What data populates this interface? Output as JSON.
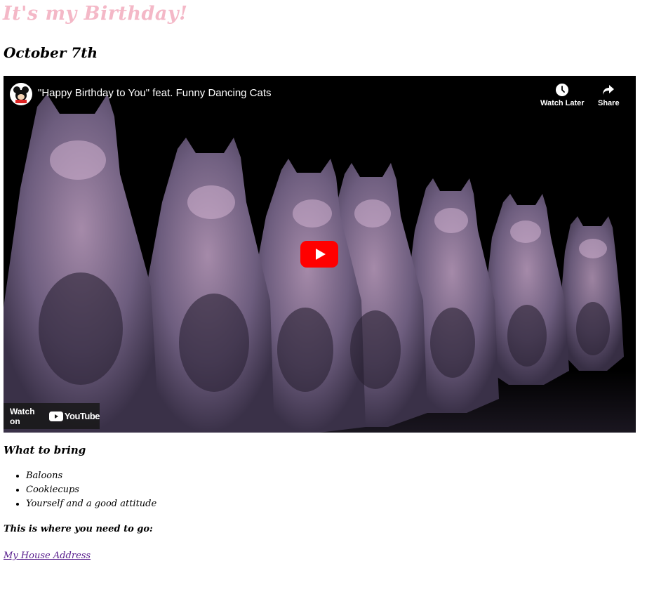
{
  "page": {
    "title": "It's my Birthday!",
    "date": "October 7th"
  },
  "video": {
    "title": "\"Happy Birthday to You\" feat. Funny Dancing Cats",
    "channel_icon": "mickey-mouse-avatar",
    "watch_later_label": "Watch Later",
    "share_label": "Share",
    "watch_on_label": "Watch on",
    "youtube_label": "YouTube",
    "play_icon": "play-icon",
    "colors": {
      "youtube_red": "#ff0000",
      "background": "#000000"
    }
  },
  "bring": {
    "heading": "What to bring",
    "items": [
      "Baloons",
      "Cookiecups",
      "Yourself and a good attitude"
    ]
  },
  "directions": {
    "text": "This is where you need to go:",
    "link_label": "My House Address"
  },
  "colors": {
    "title_pink": "#f4b8c7",
    "link_visited": "#551a8b"
  }
}
